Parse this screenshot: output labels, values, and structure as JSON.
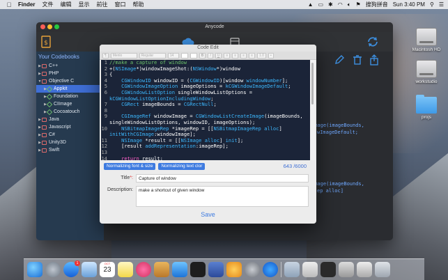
{
  "menubar": {
    "app": "Finder",
    "items": [
      "文件",
      "编辑",
      "显示",
      "前往",
      "窗口",
      "帮助"
    ],
    "input_method": "搜狗拼音",
    "clock": "Sun 3:40 PM"
  },
  "window": {
    "title": "Anycode"
  },
  "sidebar": {
    "header": "Your Codebooks",
    "items": [
      {
        "label": "C++",
        "type": "folder",
        "indent": 0,
        "state": "collapsed"
      },
      {
        "label": "PHP",
        "type": "folder",
        "indent": 0,
        "state": "collapsed"
      },
      {
        "label": "Objective C",
        "type": "folder",
        "indent": 0,
        "state": "expanded"
      },
      {
        "label": "Appkit",
        "type": "leaf",
        "indent": 1,
        "state": "selected"
      },
      {
        "label": "Foundation",
        "type": "leaf",
        "indent": 1,
        "state": "normal"
      },
      {
        "label": "CIImage",
        "type": "leaf",
        "indent": 1,
        "state": "normal"
      },
      {
        "label": "Cocoatouch",
        "type": "leaf",
        "indent": 1,
        "state": "normal"
      },
      {
        "label": "Java",
        "type": "folder",
        "indent": 0,
        "state": "collapsed"
      },
      {
        "label": "Javascript",
        "type": "folder",
        "indent": 0,
        "state": "collapsed"
      },
      {
        "label": "C#",
        "type": "folder",
        "indent": 0,
        "state": "collapsed"
      },
      {
        "label": "Unity3D",
        "type": "folder",
        "indent": 0,
        "state": "collapsed"
      },
      {
        "label": "Swift",
        "type": "folder",
        "indent": 0,
        "state": "collapsed"
      }
    ]
  },
  "background_code": {
    "line1": "Image(imageBounds,",
    "line2": "wImageDefault;",
    "line3": "Image(imageBounds,",
    "line4": "ep alloc]"
  },
  "dialog": {
    "title": "Code Edit",
    "format_bar": {
      "font": "Menlo",
      "style": "Regular",
      "size": "14"
    },
    "code_lines": [
      {
        "n": "1",
        "html": "<span class='c-comment'>//make a capture of window</span>"
      },
      {
        "n": "2",
        "html": "+(<span class='c-type'>NSImage</span>*)windowImageShot:(<span class='c-type'>NSWindow</span>*)window"
      },
      {
        "n": "3",
        "html": "{"
      },
      {
        "n": "4",
        "html": "    <span class='c-type'>CGWindowID</span> windowID = (<span class='c-type'>CGWindowID</span>)[window <span class='c-type'>windowNumber</span>];"
      },
      {
        "n": "5",
        "html": "    <span class='c-type'>CGWindowImageOption</span> imageOptions = <span class='c-type'>kCGWindowImageDefault</span>;"
      },
      {
        "n": "6",
        "html": "    <span class='c-type'>CGWindowListOption</span> singleWindowListOptions ="
      },
      {
        "n": "",
        "html": "<span class='c-type'>kCGWindowListOptionIncludingWindow</span>;"
      },
      {
        "n": "7",
        "html": "    <span class='c-type'>CGRect</span> imageBounds = <span class='c-type'>CGRectNull</span>;"
      },
      {
        "n": "8",
        "html": ""
      },
      {
        "n": "9",
        "html": "    <span class='c-type'>CGImageRef</span> windowImage = <span class='c-type'>CGWindowListCreateImage</span>(imageBounds,"
      },
      {
        "n": "",
        "html": "singleWindowListOptions, windowID, imageOptions);"
      },
      {
        "n": "10",
        "html": "    <span class='c-type'>NSBitmapImageRep</span> *imageRep = [[<span class='c-type'>NSBitmapImageRep alloc</span>]"
      },
      {
        "n": "",
        "html": "<span class='c-type'>initWithCGImage</span>:windowImage];"
      },
      {
        "n": "11",
        "html": "    <span class='c-type'>NSImage</span> *result = [[<span class='c-type'>NSImage alloc</span>] <span class='c-type'>init</span>];"
      },
      {
        "n": "12",
        "html": "    [result <span class='c-type'>addRepresentation</span>:imageRep];"
      },
      {
        "n": "13",
        "html": ""
      },
      {
        "n": "14",
        "html": "    <span class='c-kw'>return</span> result;"
      },
      {
        "n": "15",
        "html": ""
      }
    ],
    "btn_normalize_font": "Normalizing font & size",
    "btn_normalize_color": "Normalizing text clor",
    "counter": "643 /6000",
    "title_label": "Title",
    "title_required_mark": "*:",
    "title_value": "Capture of window",
    "description_label": "Description:",
    "description_value": "make a shortcut of given window",
    "save_label": "Save"
  },
  "desktop": {
    "icons": [
      "Macintosh HD",
      "workstudio",
      "projs"
    ]
  },
  "dock": {
    "badge_count": "1",
    "calendar_month": "OCT",
    "calendar_day": "23"
  },
  "colors": {
    "accent": "#3e7be0",
    "sidebar": "#263a4f",
    "selected_row": "#3f6fd6",
    "code_bg": "#1b2438"
  }
}
